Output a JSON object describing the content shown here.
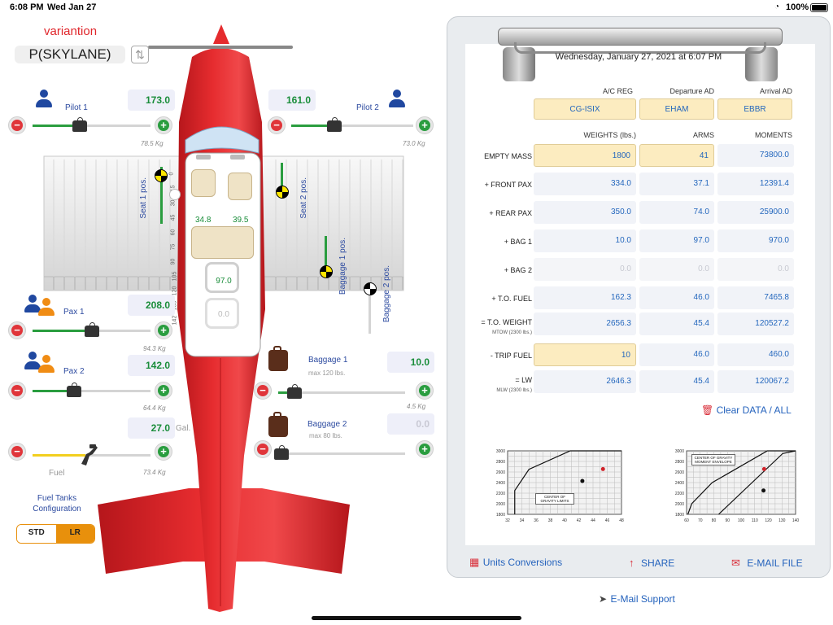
{
  "status_bar": {
    "time": "6:08 PM",
    "date": "Wed Jan 27",
    "battery": "100%"
  },
  "profile": {
    "title": "variantion",
    "aircraft": "P(SKYLANE)"
  },
  "pilot1": {
    "label": "Pilot 1",
    "value": "173.0",
    "kg": "78.5",
    "kg_unit": "Kg",
    "slider": 0.4
  },
  "pilot2": {
    "label": "Pilot 2",
    "value": "161.0",
    "kg": "73.0",
    "kg_unit": "Kg",
    "slider": 0.35
  },
  "pax1": {
    "label": "Pax 1",
    "value": "208.0",
    "kg": "94.3",
    "kg_unit": "Kg",
    "slider": 0.5
  },
  "pax2": {
    "label": "Pax 2",
    "value": "142.0",
    "kg": "64.4",
    "kg_unit": "Kg",
    "slider": 0.35
  },
  "baggage1": {
    "label": "Baggage 1",
    "max": "max 120 lbs.",
    "value": "10.0",
    "kg": "4.5",
    "kg_unit": "Kg",
    "slider": 0.08
  },
  "baggage2": {
    "label": "Baggage 2",
    "max": "max 80 lbs.",
    "value": "0.0",
    "slider": 0.0
  },
  "fuel": {
    "label": "Fuel",
    "value": "27.0",
    "unit": "Gal.",
    "kg": "73.4",
    "kg_unit": "Kg",
    "slider": 0.45
  },
  "fuel_tanks": {
    "label": "Fuel Tanks Configuration",
    "options": [
      "STD",
      "LR"
    ],
    "selected": "STD"
  },
  "cabin": {
    "front_arm": "34.8",
    "rear_arm": "39.5",
    "bag1_arm": "97.0",
    "bag2_arm": "0.0"
  },
  "ruler_ticks": [
    "0",
    "15",
    "30",
    "45",
    "60",
    "75",
    "90",
    "105",
    "120",
    "135",
    "142"
  ],
  "seat_labels": {
    "seat1": "Seat 1 pos.",
    "seat2": "Seat 2 pos.",
    "bag1": "Baggage 1 pos.",
    "bag2": "Baggage 2 pos."
  },
  "sheet": {
    "date": "Wednesday, January 27, 2021 at 6:07 PM",
    "headers": {
      "reg": "A/C REG",
      "dep": "Departure AD",
      "arr": "Arrival AD",
      "weights": "WEIGHTS (lbs.)",
      "arms": "ARMS",
      "moments": "MOMENTS"
    },
    "flight": {
      "reg": "CG-ISIX",
      "dep": "EHAM",
      "arr": "EBBR"
    },
    "rows": [
      {
        "label": "EMPTY MASS",
        "sub": "",
        "weight": "1800",
        "arm": "41",
        "moment": "73800.0"
      },
      {
        "label": "+ FRONT PAX",
        "sub": "",
        "weight": "334.0",
        "arm": "37.1",
        "moment": "12391.4"
      },
      {
        "label": "+ REAR PAX",
        "sub": "",
        "weight": "350.0",
        "arm": "74.0",
        "moment": "25900.0"
      },
      {
        "label": "+ BAG 1",
        "sub": "",
        "weight": "10.0",
        "arm": "97.0",
        "moment": "970.0"
      },
      {
        "label": "+ BAG 2",
        "sub": "",
        "weight": "0.0",
        "arm": "0.0",
        "moment": "0.0"
      },
      {
        "label": "+ T.O. FUEL",
        "sub": "",
        "weight": "162.3",
        "arm": "46.0",
        "moment": "7465.8"
      },
      {
        "label": "= T.O. WEIGHT",
        "sub": "MTOW (2300 lbs.)",
        "weight": "2656.3",
        "arm": "45.4",
        "moment": "120527.2"
      },
      {
        "label": "- TRIP FUEL",
        "sub": "",
        "weight": "10",
        "arm": "46.0",
        "moment": "460.0"
      },
      {
        "label": "= LW",
        "sub": "MLW (2300 lbs.)",
        "weight": "2646.3",
        "arm": "45.4",
        "moment": "120067.2"
      }
    ],
    "clear_label": "Clear DATA / ALL"
  },
  "toolbar": {
    "units": "Units Conversions",
    "share": "SHARE",
    "email": "E-MAIL FILE"
  },
  "support": "E-Mail Support",
  "chart_data": [
    {
      "type": "line",
      "title": "CENTER OF GRAVITY LIMITS",
      "x_ticks": [
        "32",
        "34",
        "36",
        "38",
        "40",
        "42",
        "44",
        "46",
        "48"
      ],
      "y_ticks": [
        "1800",
        "2000",
        "2200",
        "2400",
        "2600",
        "2800",
        "3000"
      ],
      "xlim": [
        32,
        48
      ],
      "ylim": [
        1800,
        3000
      ],
      "series": [
        {
          "x": [
            33,
            33,
            35,
            40.8,
            48
          ],
          "y": [
            1800,
            2250,
            2650,
            3000,
            3000
          ]
        }
      ],
      "points": [
        {
          "x": 45.4,
          "y": 2656,
          "color": "#d0232a"
        },
        {
          "x": 42.5,
          "y": 2430,
          "color": "#111111"
        }
      ]
    },
    {
      "type": "line",
      "title": "CENTER OF GRAVITY MOMENT ENVELOPE",
      "x_ticks": [
        "60",
        "70",
        "80",
        "90",
        "100",
        "110",
        "120",
        "130",
        "140"
      ],
      "y_ticks": [
        "1800",
        "2000",
        "2200",
        "2400",
        "2600",
        "2800",
        "3000"
      ],
      "xlim": [
        60,
        145
      ],
      "ylim": [
        1800,
        3000
      ],
      "series": [
        {
          "x": [
            61,
            64,
            80,
            123,
            145
          ],
          "y": [
            1800,
            2000,
            2400,
            3000,
            3000
          ]
        },
        {
          "x": [
            85,
            135,
            145
          ],
          "y": [
            1800,
            2950,
            3000
          ]
        }
      ],
      "points": [
        {
          "x": 120.5,
          "y": 2656,
          "color": "#d0232a"
        },
        {
          "x": 120,
          "y": 2250,
          "color": "#111111"
        }
      ]
    }
  ]
}
